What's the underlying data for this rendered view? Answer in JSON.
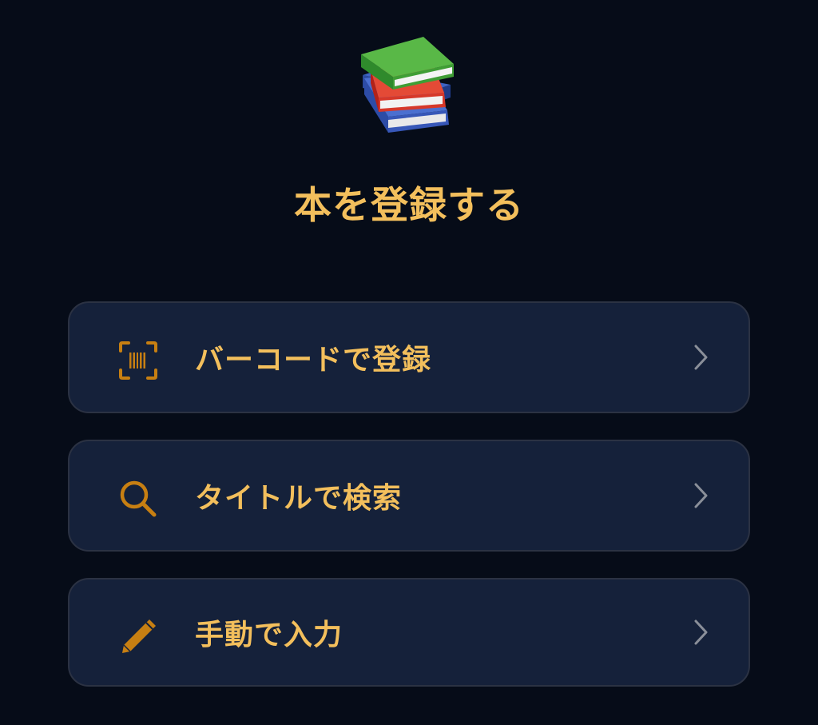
{
  "page": {
    "title": "本を登録する",
    "hero_icon": "books-emoji-icon"
  },
  "options": [
    {
      "icon": "barcode-scan-icon",
      "label": "バーコードで登録"
    },
    {
      "icon": "search-icon",
      "label": "タイトルで検索"
    },
    {
      "icon": "pencil-icon",
      "label": "手動で入力"
    }
  ],
  "colors": {
    "background": "#060c18",
    "card": "#15213a",
    "card_border": "#2b3243",
    "accent": "#f3bf5c",
    "icon": "#c77f12",
    "chevron": "#8a8f99"
  }
}
